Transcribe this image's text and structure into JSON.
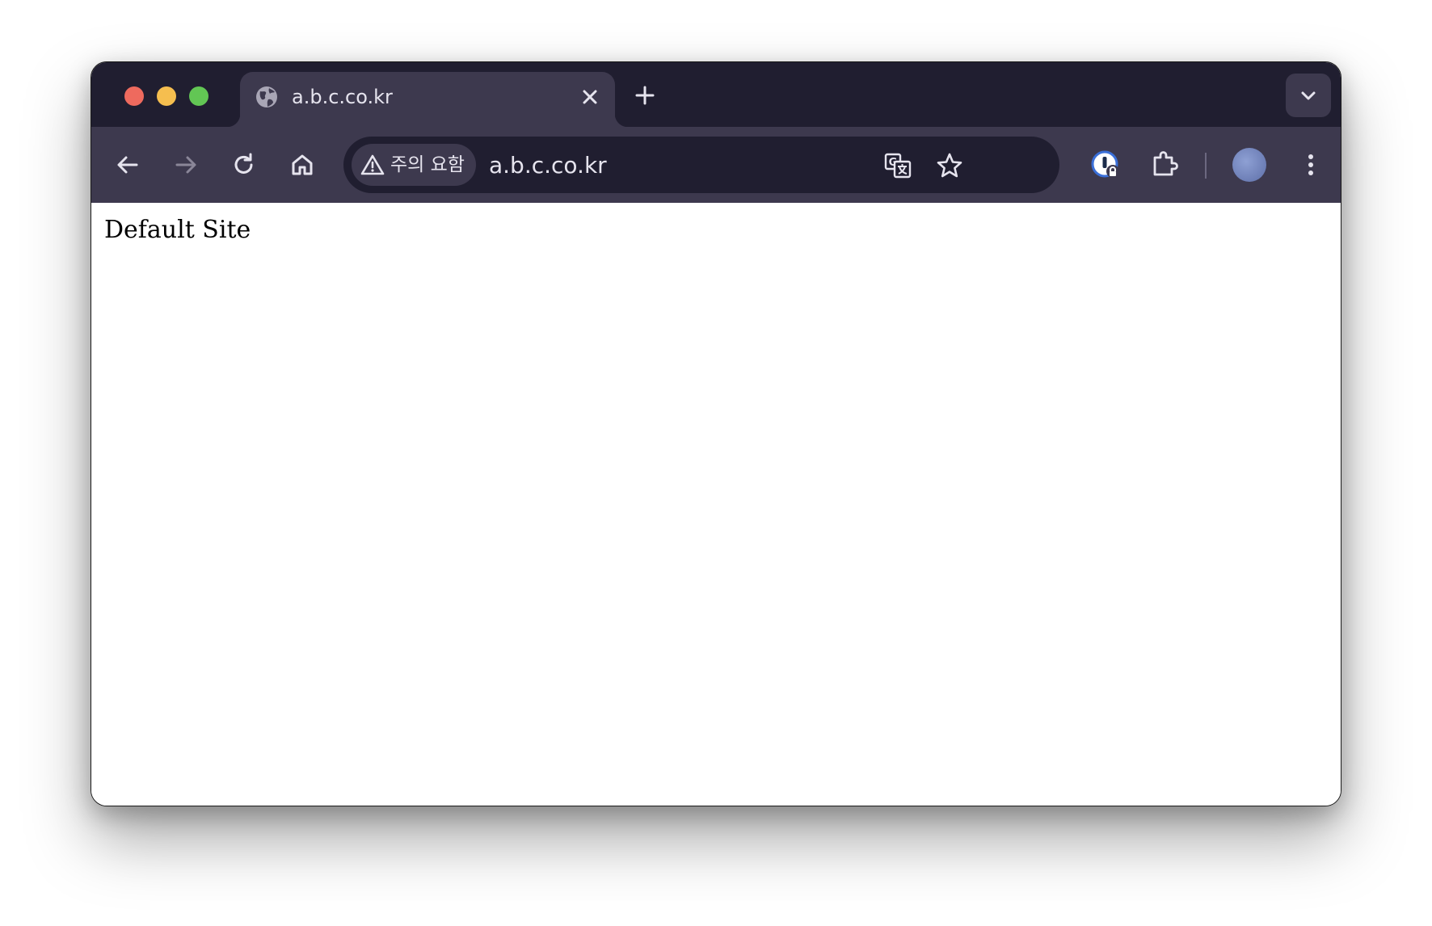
{
  "window": {
    "tab": {
      "title": "a.b.c.co.kr",
      "favicon": "globe-icon"
    },
    "toolbar": {
      "security_label": "주의 요함",
      "url": "a.b.c.co.kr"
    },
    "content": {
      "text": "Default Site"
    }
  },
  "colors": {
    "tabstrip_bg": "#201e30",
    "toolbar_bg": "#3d394e",
    "text": "#e6e4ee"
  }
}
